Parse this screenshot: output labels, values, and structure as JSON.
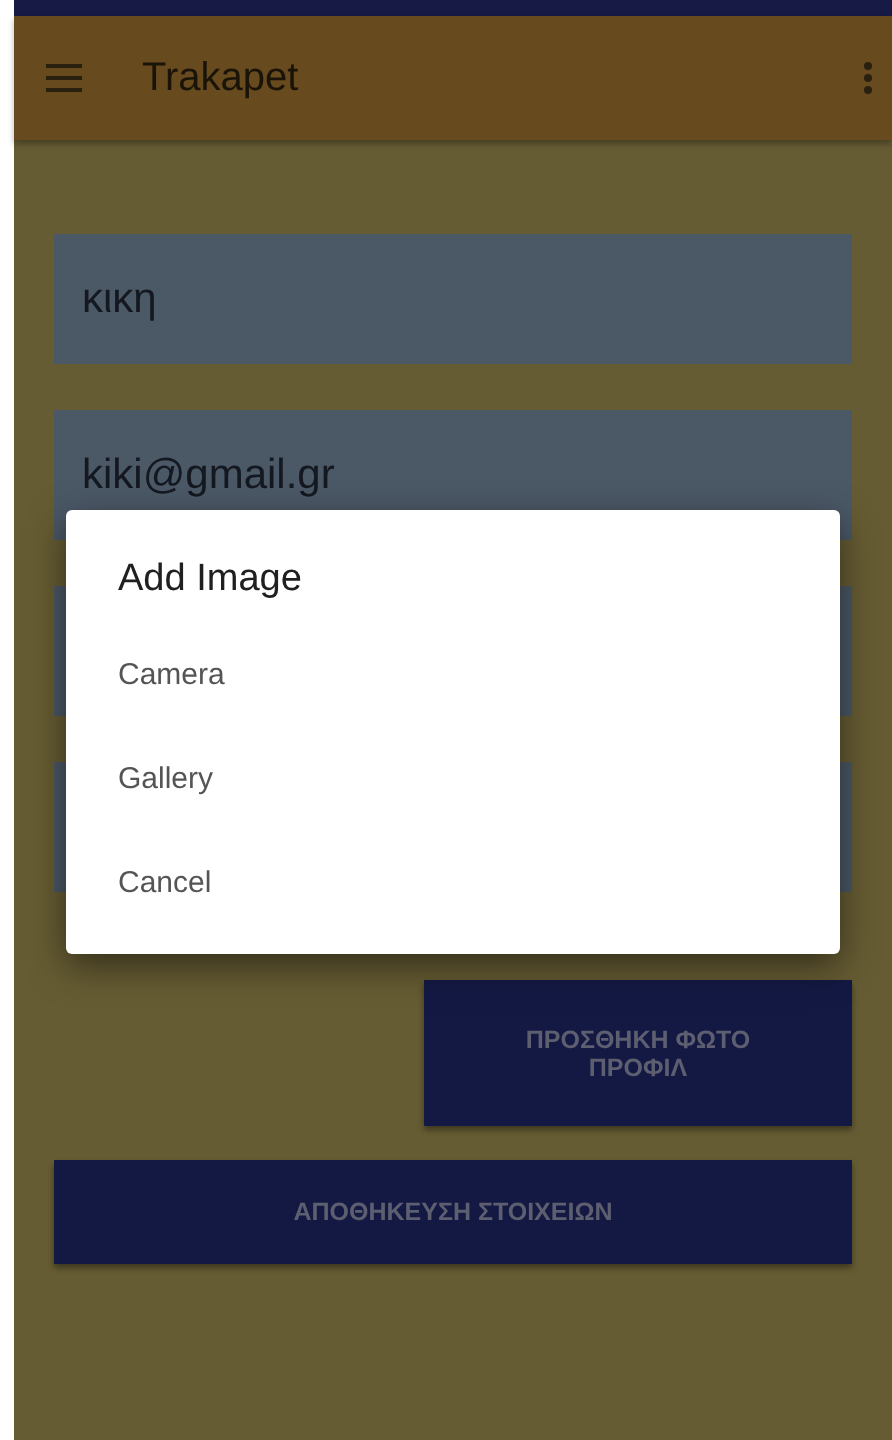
{
  "app_bar": {
    "title": "Trakapet"
  },
  "fields": [
    {
      "value": "κικη"
    },
    {
      "value": "kiki@gmail.gr"
    }
  ],
  "photo_button": {
    "label": "ΠΡΟΣΘΗΚΗ ΦΩΤΟ ΠΡΟΦΙΛ"
  },
  "save_button": {
    "label": "ΑΠΟΘΗΚΕΥΣΗ ΣΤΟΙΧΕΙΩΝ"
  },
  "dialog": {
    "title": "Add Image",
    "options": [
      "Camera",
      "Gallery",
      "Cancel"
    ]
  }
}
